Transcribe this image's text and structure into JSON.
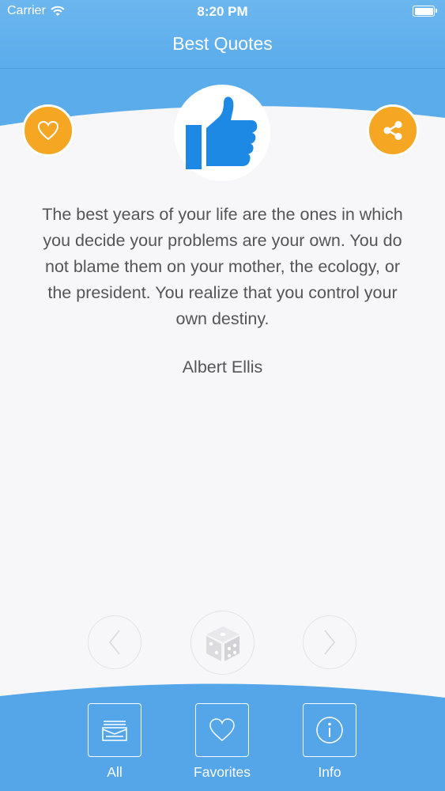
{
  "status_bar": {
    "carrier": "Carrier",
    "time": "8:20 PM"
  },
  "header": {
    "title": "Best Quotes"
  },
  "quote": {
    "text": "The best years of your life are the ones in which you decide your problems are your own. You do not blame them on your mother, the ecology, or the president. You realize that you control your own destiny.",
    "author": "Albert Ellis"
  },
  "icons": {
    "favorite": "heart-icon",
    "share": "share-icon",
    "category": "thumbs-up-icon",
    "prev": "chevron-left-icon",
    "random": "dice-icon",
    "next": "chevron-right-icon"
  },
  "tabs": [
    {
      "label": "All",
      "icon": "stack-icon"
    },
    {
      "label": "Favorites",
      "icon": "heart-icon"
    },
    {
      "label": "Info",
      "icon": "info-icon"
    }
  ],
  "colors": {
    "header": "#5aaceb",
    "accent": "#f5a623",
    "thumb": "#1e88e5",
    "background": "#f7f7f9"
  }
}
